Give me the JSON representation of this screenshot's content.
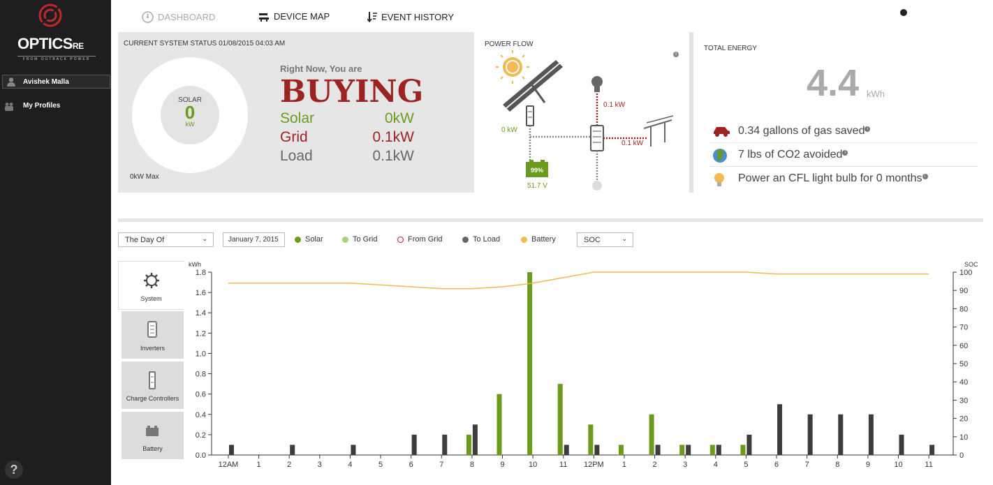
{
  "brand": {
    "title": "OPTICS",
    "suffix": "RE",
    "tagline": "FROM OUTBACK POWER"
  },
  "sidebar": {
    "user": "Avishek Malla",
    "items": [
      {
        "label": "My Profiles"
      }
    ],
    "help": "?"
  },
  "nav": {
    "dashboard": "DASHBOARD",
    "device_map": "DEVICE MAP",
    "event_history": "EVENT HISTORY"
  },
  "status": {
    "title": "CURRENT SYSTEM STATUS 01/08/2015 04:03 AM",
    "donut_label": "SOLAR",
    "donut_value": "0",
    "donut_unit": "kW",
    "max_label": "0kW Max",
    "right_now": "Right Now, You are",
    "mode": "BUYING",
    "rows": [
      {
        "name": "Solar",
        "value": "0kW"
      },
      {
        "name": "Grid",
        "value": "0.1kW"
      },
      {
        "name": "Load",
        "value": "0.1kW"
      }
    ]
  },
  "power_flow": {
    "title": "POWER FLOW",
    "info": "i",
    "solar_kw": "0 kW",
    "load_kw": "0.1 kW",
    "grid_kw": "0.1 kW",
    "battery_pct": "99%",
    "battery_v": "51.7 V"
  },
  "total_energy": {
    "title": "TOTAL ENERGY",
    "value": "4.4",
    "unit": "kWh",
    "rows": [
      {
        "label": "0.34 gallons of gas saved",
        "icon": "car-icon"
      },
      {
        "label": "7 lbs of CO2 avoided",
        "icon": "globe-icon"
      },
      {
        "label": "Power an CFL light bulb for 0 months",
        "icon": "bulb-icon"
      }
    ]
  },
  "controls": {
    "range": "The Day Of",
    "date": "January 7, 2015",
    "metric": "SOC",
    "legend": [
      {
        "label": "Solar",
        "color": "#6b9b1c",
        "style": "fill"
      },
      {
        "label": "To Grid",
        "color": "#a8d37a",
        "style": "fill"
      },
      {
        "label": "From Grid",
        "color": "#9b2321",
        "style": "ring"
      },
      {
        "label": "To Load",
        "color": "#666666",
        "style": "fill"
      },
      {
        "label": "Battery",
        "color": "#f2b950",
        "style": "fill"
      }
    ]
  },
  "tabs": [
    {
      "label": "System",
      "icon": "gear-icon"
    },
    {
      "label": "Inverters",
      "icon": "inverter-icon"
    },
    {
      "label": "Charge Controllers",
      "icon": "charge-controller-icon"
    },
    {
      "label": "Battery",
      "icon": "battery-icon"
    }
  ],
  "colors": {
    "solar": "#6b9b1c",
    "grid": "#9b2321",
    "load": "#3c3c3c",
    "battery": "#f2b950"
  },
  "chart_data": {
    "type": "bar",
    "categories": [
      "12AM",
      "1",
      "2",
      "3",
      "4",
      "5",
      "6",
      "7",
      "8",
      "9",
      "10",
      "11",
      "12PM",
      "1",
      "2",
      "3",
      "4",
      "5",
      "6",
      "7",
      "8",
      "9",
      "10",
      "11"
    ],
    "series": [
      {
        "name": "Solar",
        "values": [
          0,
          0,
          0,
          0,
          0,
          0,
          0,
          0,
          0.2,
          0.6,
          1.8,
          0.7,
          0.3,
          0.1,
          0.4,
          0.1,
          0.1,
          0.1,
          0,
          0,
          0,
          0,
          0,
          0
        ]
      },
      {
        "name": "To Load",
        "values": [
          0.1,
          0,
          0.1,
          0,
          0.1,
          0,
          0.2,
          0.2,
          0.3,
          0,
          0,
          0.1,
          0.1,
          0,
          0.1,
          0.1,
          0.1,
          0.2,
          0.5,
          0.4,
          0.4,
          0.4,
          0.2,
          0.1
        ]
      },
      {
        "name": "Battery",
        "axis": "right",
        "values": [
          94,
          94,
          94,
          94,
          94,
          93,
          92,
          91,
          91,
          92,
          94,
          97,
          100,
          100,
          100,
          100,
          100,
          100,
          99,
          99,
          99,
          99,
          99,
          99
        ]
      }
    ],
    "ylabel": "kWh",
    "ylim": [
      0,
      1.8
    ],
    "yticks": [
      "0.0",
      "0.2",
      "0.4",
      "0.6",
      "0.8",
      "1.0",
      "1.2",
      "1.4",
      "1.6",
      "1.8"
    ],
    "y2label": "SOC",
    "y2lim": [
      0,
      100
    ],
    "y2ticks": [
      "0",
      "10",
      "20",
      "30",
      "40",
      "50",
      "60",
      "70",
      "80",
      "90",
      "100"
    ]
  }
}
